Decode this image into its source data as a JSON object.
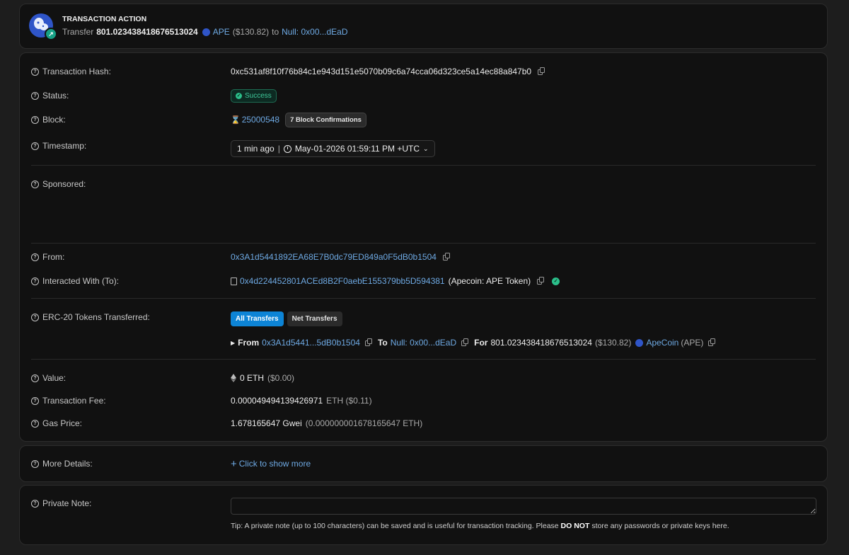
{
  "action": {
    "title": "TRANSACTION ACTION",
    "verb": "Transfer",
    "amount": "801.023438418676513024",
    "token": "APE",
    "usd": "($130.82)",
    "to_word": "to",
    "to_addr": "Null: 0x00...dEaD"
  },
  "details": {
    "hash_label": "Transaction Hash:",
    "hash": "0xc531af8f10f76b84c1e943d151e5070b09c6a74cca06d323ce5a14ec88a847b0",
    "status_label": "Status:",
    "status": "Success",
    "block_label": "Block:",
    "block": "25000548",
    "confirmations": "7 Block Confirmations",
    "timestamp_label": "Timestamp:",
    "age": "1 min ago",
    "datetime": "May-01-2026 01:59:11 PM +UTC",
    "sponsored_label": "Sponsored:",
    "from_label": "From:",
    "from": "0x3A1d5441892EA68E7B0dc79ED849a0F5dB0b1504",
    "to_label": "Interacted With (To):",
    "to_contract": "0x4d224452801ACEd8B2F0aebE155379bb5D594381",
    "to_name": "(Apecoin: APE Token)",
    "erc20_label": "ERC-20 Tokens Transferred:",
    "tab_all": "All Transfers",
    "tab_net": "Net Transfers",
    "transfer": {
      "from_word": "From",
      "from_addr": "0x3A1d5441...5dB0b1504",
      "to_word": "To",
      "to_addr": "Null: 0x00...dEaD",
      "for_word": "For",
      "amount": "801.023438418676513024",
      "usd": "($130.82)",
      "token_name": "ApeCoin",
      "token_sym": "(APE)"
    },
    "value_label": "Value:",
    "value": "0 ETH",
    "value_usd": "($0.00)",
    "fee_label": "Transaction Fee:",
    "fee": "0.000049494139426971",
    "fee_unit": "ETH ($0.11)",
    "gas_label": "Gas Price:",
    "gas": "1.678165647 Gwei",
    "gas_eth": "(0.000000001678165647 ETH)"
  },
  "more": {
    "label": "More Details:",
    "link": "Click to show more"
  },
  "note": {
    "label": "Private Note:",
    "tip_prefix": "Tip: A private note (up to 100 characters) can be saved and is useful for transaction tracking. Please",
    "tip_bold": "DO NOT",
    "tip_suffix": "store any passwords or private keys here."
  },
  "colors": {
    "accent": "#6ea9e3",
    "success": "#2bbf8a",
    "primary_button": "#0d84d6"
  }
}
